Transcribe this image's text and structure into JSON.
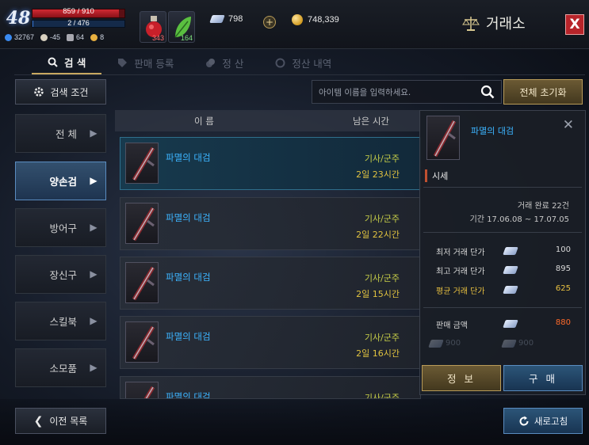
{
  "player": {
    "level": "48",
    "hp": "859 / 910",
    "mp": "2 / 476",
    "stats": [
      "32767",
      "-45",
      "64",
      "8"
    ]
  },
  "consumables": {
    "potion_count": "343",
    "leaf_count": "164"
  },
  "currency": {
    "crystals": "798",
    "plus": "+",
    "gold": "748,339"
  },
  "header": {
    "title": "거래소",
    "close": "X"
  },
  "tabs": [
    {
      "label": "검 색"
    },
    {
      "label": "판매 등록"
    },
    {
      "label": "정 산"
    },
    {
      "label": "정산 내역"
    }
  ],
  "search": {
    "condition_label": "검색 조건",
    "placeholder": "아이템 이름을 입력하세요.",
    "reset_label": "전체 초기화"
  },
  "categories": [
    {
      "label": "전 체"
    },
    {
      "label": "양손검"
    },
    {
      "label": "방어구"
    },
    {
      "label": "장신구"
    },
    {
      "label": "스킬북"
    },
    {
      "label": "소모품"
    }
  ],
  "list": {
    "col_name": "이 름",
    "col_time": "남은 시간",
    "rows": [
      {
        "name": "파멸의 대검",
        "class": "기사/군주",
        "time": "2일 23시간"
      },
      {
        "name": "파멸의 대검",
        "class": "기사/군주",
        "time": "2일 22시간"
      },
      {
        "name": "파멸의 대검",
        "class": "기사/군주",
        "time": "2일 15시간"
      },
      {
        "name": "파멸의 대검",
        "class": "기사/군주",
        "time": "2일 16시간"
      },
      {
        "name": "파멸의 대검",
        "class": "기사/군주",
        "time": ""
      }
    ]
  },
  "detail": {
    "name": "파멸의 대검",
    "section": "시세",
    "completed": "거래 완료 22건",
    "period": "기간 17.06.08 ~ 17.07.05",
    "min_label": "최저 거래 단가",
    "min_value": "100",
    "max_label": "최고 거래 단가",
    "max_value": "895",
    "avg_label": "평균 거래 단가",
    "avg_value": "625",
    "sale_label": "판매 금액",
    "sale_value": "880",
    "ghost_left": "900",
    "ghost_right": "900",
    "info_label": "정 보",
    "buy_label": "구 매"
  },
  "footer": {
    "prev_label": "이전 목록",
    "refresh_label": "새로고침"
  }
}
